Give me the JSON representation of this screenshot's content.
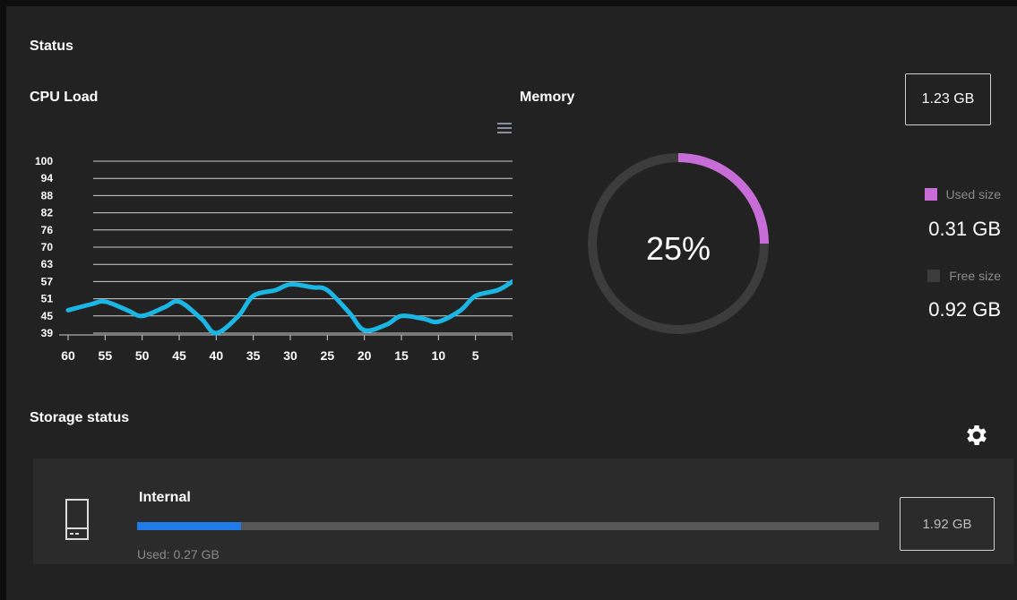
{
  "status_title": "Status",
  "cpu": {
    "title": "CPU Load"
  },
  "memory": {
    "title": "Memory",
    "total": "1.23 GB",
    "percent_label": "25%",
    "percent": 25,
    "used_label": "Used size",
    "used_value": "0.31 GB",
    "free_label": "Free size",
    "free_value": "0.92 GB",
    "used_color": "#c86dd7",
    "free_color": "#3c3c3c"
  },
  "storage": {
    "title": "Storage status",
    "name": "Internal",
    "used_text": "Used: 0.27 GB",
    "total": "1.92 GB",
    "used_fraction": 0.14,
    "bar_color": "#1f7bea"
  },
  "icons": {
    "chart_menu": "hamburger-menu-icon",
    "settings": "gear-icon",
    "drive": "storage-drive-icon"
  },
  "chart_data": {
    "type": "line",
    "title": "",
    "xlabel": "",
    "ylabel": "",
    "y_ticks": [
      100,
      94,
      88,
      82,
      76,
      70,
      63,
      57,
      51,
      45,
      39
    ],
    "x_ticks": [
      60,
      55,
      50,
      45,
      40,
      35,
      30,
      25,
      20,
      15,
      10,
      5
    ],
    "xlim": [
      60,
      0
    ],
    "ylim": [
      39,
      100
    ],
    "grid": true,
    "line_color": "#1ab6e4",
    "series": [
      {
        "x": [
          60,
          57,
          55,
          52,
          50,
          47,
          45,
          42,
          40,
          37,
          35,
          32,
          30,
          27,
          25,
          22,
          20,
          17,
          15,
          12,
          10,
          7,
          5,
          2,
          0
        ],
        "values": [
          47,
          49,
          50,
          47,
          45,
          48,
          50,
          44,
          38,
          45,
          52,
          54,
          56,
          55,
          54,
          46,
          40,
          42,
          45,
          44,
          43,
          47,
          52,
          54,
          57
        ]
      }
    ]
  }
}
